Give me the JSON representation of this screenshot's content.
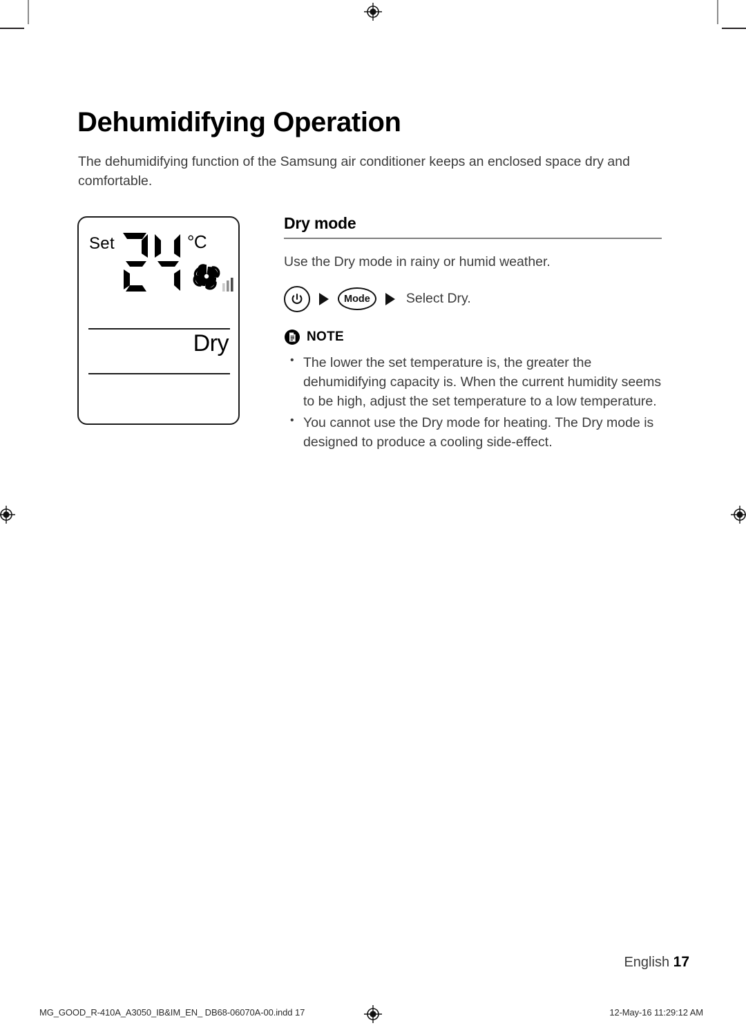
{
  "document": {
    "title": "Dehumidifying Operation",
    "intro": "The dehumidifying function of the Samsung air conditioner keeps an enclosed space dry and comfortable."
  },
  "display_panel": {
    "set_label": "Set",
    "temperature": "24",
    "unit": "°C",
    "mode_label": "Dry",
    "fan_icon": "fan-icon",
    "fan_bars": "signal-bars-icon"
  },
  "section": {
    "heading": "Dry mode",
    "lead": "Use the Dry mode in rainy or humid weather."
  },
  "button_sequence": {
    "power_button": "power-icon",
    "arrow_1": "▶",
    "mode_button": "Mode",
    "arrow_2": "▶",
    "result_text": "Select Dry."
  },
  "note": {
    "icon": "note-document-icon",
    "title": "NOTE",
    "items": [
      "The lower the set temperature is, the greater the dehumidifying capacity is. When the current humidity seems to be high, adjust the set temperature to a low temperature.",
      "You cannot use the Dry mode for heating. The Dry mode is designed to produce a cooling side-effect."
    ]
  },
  "footer": {
    "language": "English",
    "page_number": "17",
    "file_name": "MG_GOOD_R-410A_A3050_IB&IM_EN_ DB68-06070A-00.indd   17",
    "timestamp": "12-May-16   11:29:12 AM"
  },
  "colors": {
    "text": "#3b3b3b",
    "heading": "#000000",
    "rule": "#7d7d7d",
    "crop_mark": "#8a8a8a"
  }
}
